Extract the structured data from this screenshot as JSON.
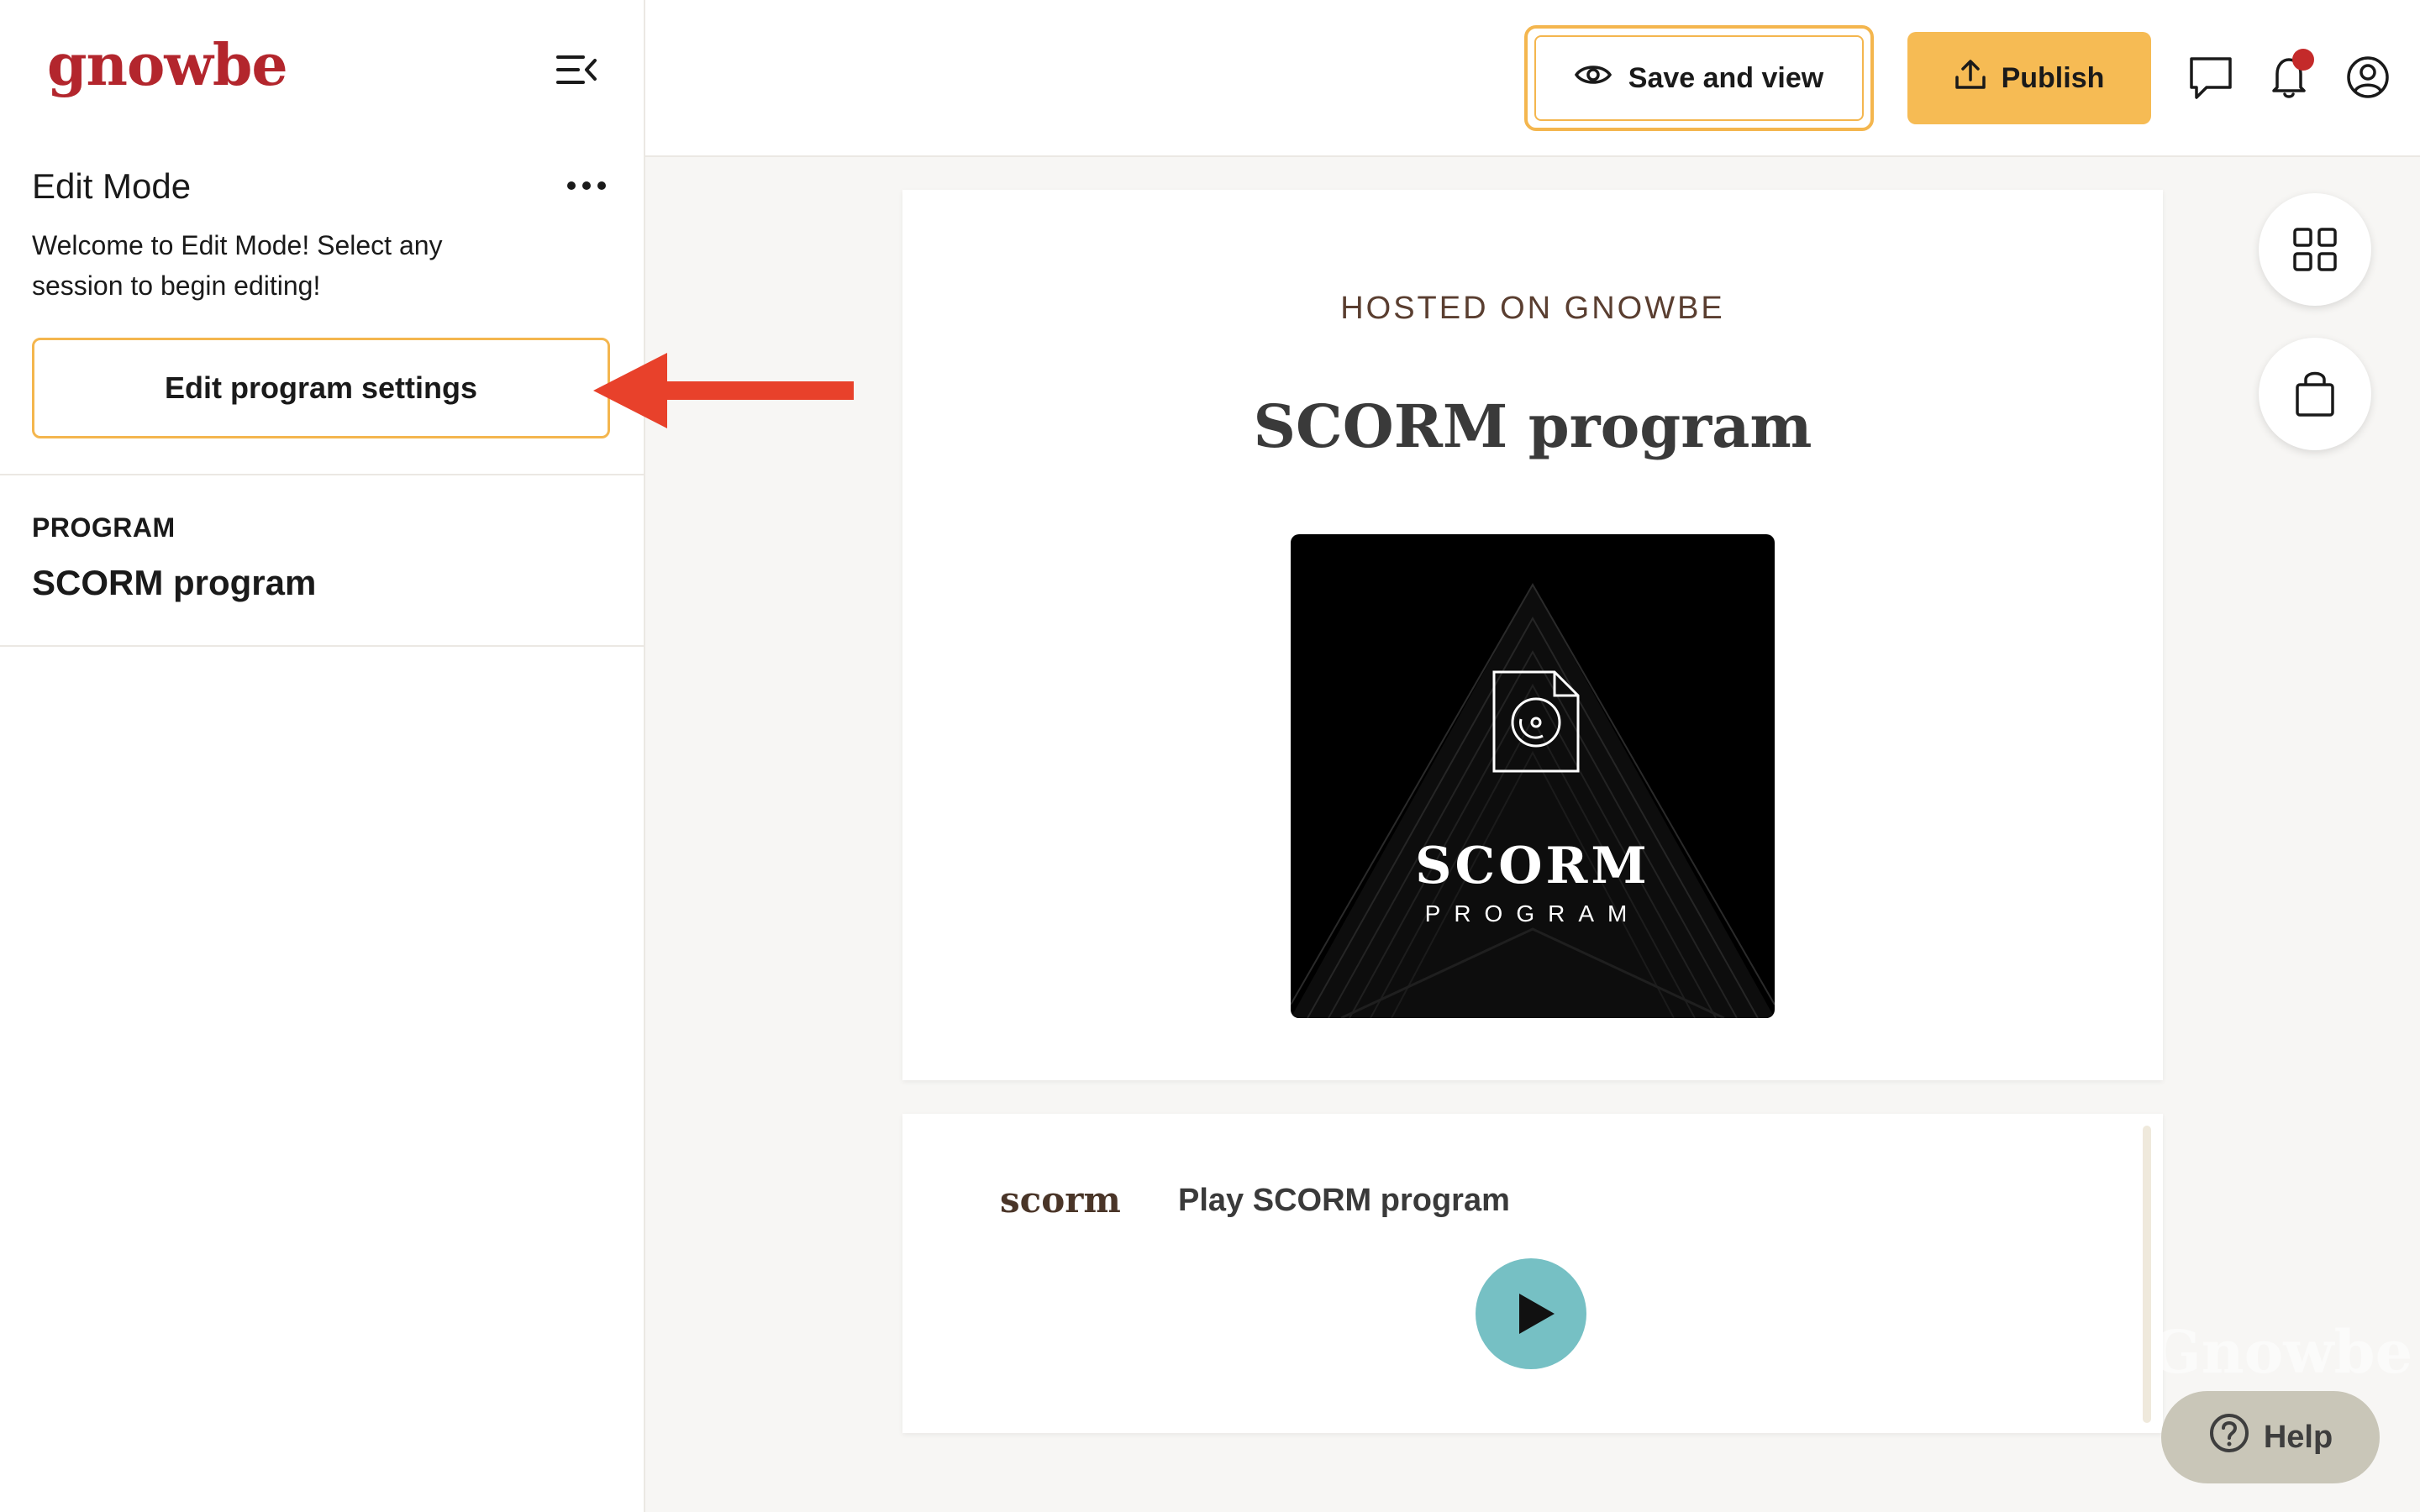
{
  "sidebar": {
    "logo": "gnowbe",
    "edit_mode_title": "Edit Mode",
    "edit_mode_description": "Welcome to Edit Mode! Select any session to begin editing!",
    "settings_button": "Edit program settings",
    "program_label": "PROGRAM",
    "program_name": "SCORM program"
  },
  "topbar": {
    "save_button": "Save and view",
    "publish_button": "Publish",
    "has_notification": true
  },
  "main": {
    "hosted_label": "HOSTED ON GNOWBE",
    "title": "SCORM program",
    "cover": {
      "line1": "SCORM",
      "line2": "PROGRAM"
    },
    "scorm_card": {
      "logo_text": "scorm",
      "title": "Play SCORM program"
    }
  },
  "help_button": "Help",
  "watermark": "Gnowbe",
  "colors": {
    "brand_red": "#b3262d",
    "accent_orange": "#f6bb54",
    "play_teal": "#76c0c4",
    "arrow_red": "#e8412b"
  }
}
